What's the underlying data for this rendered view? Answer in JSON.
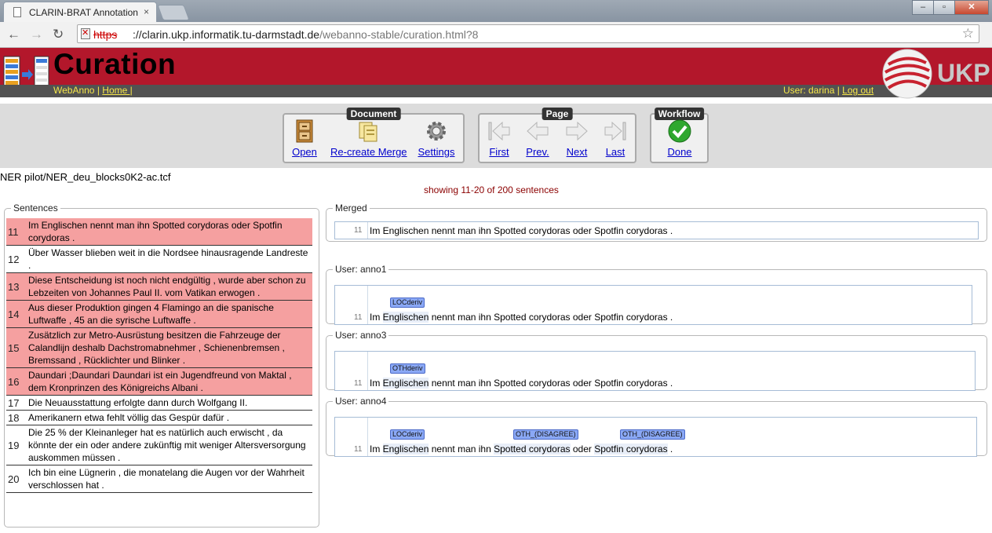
{
  "browser": {
    "tab_title": "CLARIN-BRAT Annotation",
    "tab_close": "×",
    "url_protocol": "https",
    "url_host": "://clarin.ukp.informatik.tu-darmstadt.de",
    "url_path": "/webanno-stable/curation.html?8"
  },
  "header": {
    "title": "Curation",
    "app_link": "WebAnno",
    "separator": "|",
    "home_link": "Home |",
    "user_label": "User: darina |",
    "logout_link": "Log out",
    "brand": "UKP"
  },
  "actions": {
    "document_group": "Document",
    "open": "Open",
    "recreate": "Re-create Merge",
    "settings": "Settings",
    "page_group": "Page",
    "first": "First",
    "prev": "Prev.",
    "next": "Next",
    "last": "Last",
    "workflow_group": "Workflow",
    "done": "Done"
  },
  "doc": {
    "filename": "NER pilot/NER_deu_blocks0K2-ac.tcf",
    "showing": "showing 11-20 of 200 sentences"
  },
  "sentences": {
    "legend": "Sentences",
    "items": [
      {
        "num": "11",
        "text": "Im Englischen nennt man ihn Spotted corydoras oder Spotfin corydoras .",
        "disagree": true
      },
      {
        "num": "12",
        "text": "Über Wasser blieben weit in die Nordsee hinausragende Landreste .",
        "disagree": false
      },
      {
        "num": "13",
        "text": "Diese Entscheidung ist noch nicht endgültig , wurde aber schon zu Lebzeiten von Johannes Paul II. vom Vatikan erwogen .",
        "disagree": true
      },
      {
        "num": "14",
        "text": "Aus dieser Produktion gingen 4 Flamingo an die spanische Luftwaffe , 45 an die syrische Luftwaffe .",
        "disagree": true
      },
      {
        "num": "15",
        "text": "Zusätzlich zur Metro-Ausrüstung besitzen die Fahrzeuge der Calandlijn deshalb Dachstromabnehmer , Schienenbremsen , Bremssand , Rücklichter und Blinker .",
        "disagree": true
      },
      {
        "num": "16",
        "text": "Daundari ;Daundari Daundari ist ein Jugendfreund von Maktal , dem Kronprinzen des Königreichs Albani .",
        "disagree": true
      },
      {
        "num": "17",
        "text": "Die Neuausstattung erfolgte dann durch Wolfgang II.",
        "disagree": false
      },
      {
        "num": "18",
        "text": "Amerikanern etwa fehlt völlig das Gespür dafür .",
        "disagree": false
      },
      {
        "num": "19",
        "text": "Die 25 % der Kleinanleger hat es natürlich auch erwischt , da könnte der ein oder andere zukünftig mit weniger Altersversorgung auskommen müssen .",
        "disagree": false
      },
      {
        "num": "20",
        "text": "Ich bin eine Lügnerin , die monatelang die Augen vor der Wahrheit verschlossen hat .",
        "disagree": false
      }
    ]
  },
  "panels": {
    "merged_legend": "Merged",
    "anno1_legend": "User: anno1",
    "anno3_legend": "User: anno3",
    "anno4_legend": "User: anno4",
    "line_num": "11",
    "s_pre": "Im ",
    "s_englischen": "Englischen",
    "s_mid": " nennt man ihn ",
    "s_spotted": "Spotted corydoras",
    "s_oder": " oder ",
    "s_spotfin": "Spotfin corydoras",
    "s_end": " .",
    "merged_text": "Im Englischen nennt man ihn Spotted corydoras oder Spotfin corydoras .",
    "anno1_label": "LOCderiv",
    "anno3_label": "OTHderiv",
    "anno4_label1": "LOCderiv",
    "anno4_label2": "OTH_(DISAGREE)",
    "anno4_label3": "OTH_(DISAGREE)"
  },
  "colors": {
    "header_red": "#b3172b",
    "disagree_row": "#f5a0a0",
    "span_blue": "#8aa8f5",
    "link_yellow": "#f5e64a"
  },
  "icons": [
    "document-page-icon",
    "cabinet-icon",
    "documents-icon",
    "gear-icon",
    "first-page-icon",
    "prev-arrow-icon",
    "next-arrow-icon",
    "last-page-icon",
    "check-icon",
    "star-icon",
    "ukp-globe-icon"
  ]
}
